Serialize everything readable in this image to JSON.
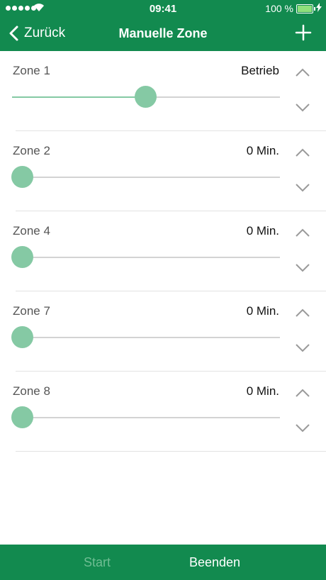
{
  "status_bar": {
    "time": "09:41",
    "battery": "100 %"
  },
  "nav": {
    "back_label": "Zurück",
    "title": "Manuelle Zone",
    "add_icon": "plus-icon"
  },
  "zones": [
    {
      "name": "Zone 1",
      "value": "Betrieb",
      "slider_level": 0.5
    },
    {
      "name": "Zone 2",
      "value": "0 Min.",
      "slider_level": 0.0
    },
    {
      "name": "Zone 4",
      "value": "0 Min.",
      "slider_level": 0.0
    },
    {
      "name": "Zone 7",
      "value": "0 Min.",
      "slider_level": 0.0
    },
    {
      "name": "Zone 8",
      "value": "0 Min.",
      "slider_level": 0.0
    }
  ],
  "footer": {
    "start_label": "Start",
    "stop_label": "Beenden"
  },
  "colors": {
    "brand": "#128a4f",
    "slider": "#85c9a4",
    "start_disabled": "#6fbd93"
  }
}
